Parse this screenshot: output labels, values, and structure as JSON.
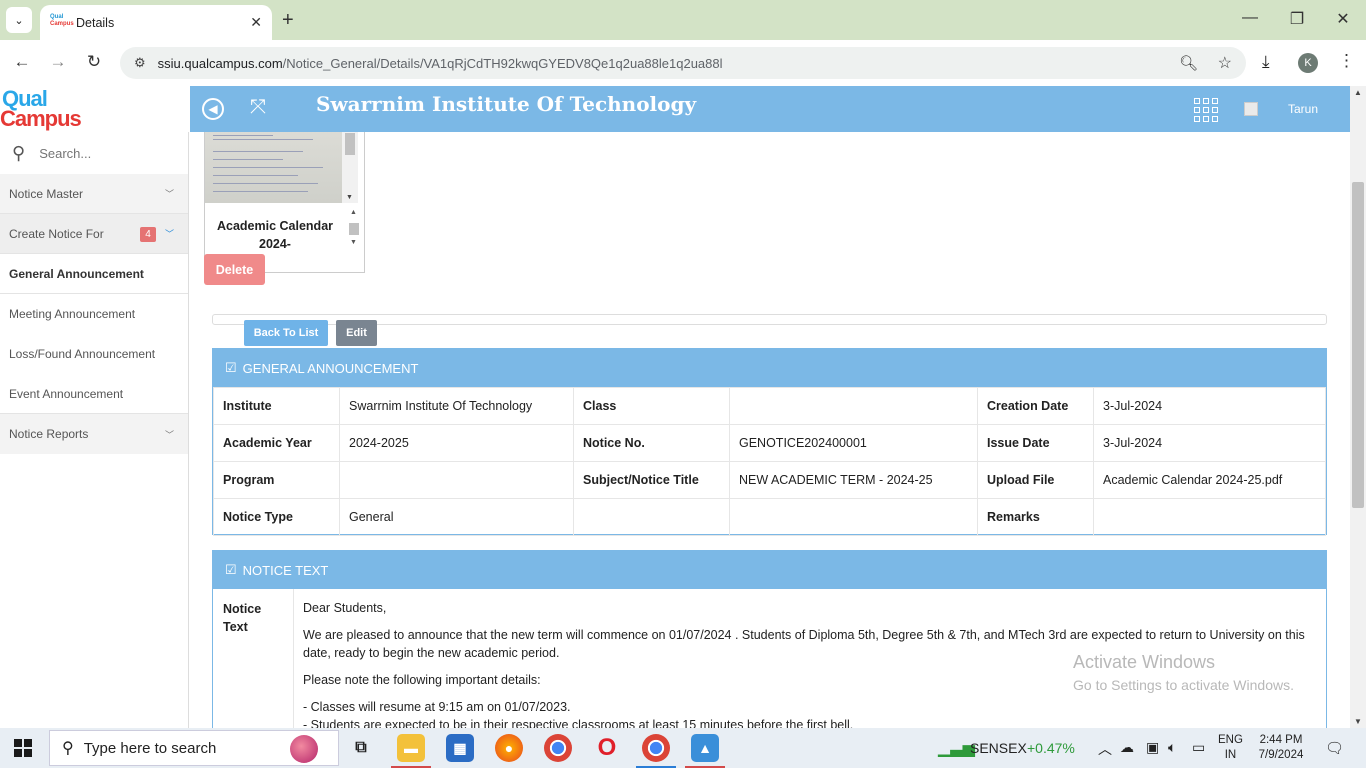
{
  "browser": {
    "tab_title": "Details",
    "favicon_text_1": "Qual",
    "favicon_text_2": "Campus",
    "url_host": "ssiu.qualcampus.com",
    "url_path": "/Notice_General/Details/VA1qRjCdTH92kwqGYEDV8Qe1q2ua88le1q2ua88l",
    "profile_initial": "K"
  },
  "header": {
    "logo_top": "Qual",
    "logo_bottom": "Campus",
    "title": "Swarrnim Institute Of Technology",
    "user_name": "Tarun"
  },
  "sidebar": {
    "search_placeholder": "Search...",
    "items": [
      {
        "label": "Notice Master",
        "has_chevron": true
      },
      {
        "label": "Create Notice For",
        "badge": "4",
        "has_chevron": true
      },
      {
        "label": "General Announcement"
      },
      {
        "label": "Meeting Announcement"
      },
      {
        "label": "Loss/Found Announcement"
      },
      {
        "label": "Event Announcement"
      },
      {
        "label": "Notice Reports",
        "has_chevron": true
      }
    ]
  },
  "attachment": {
    "name": "Academic Calendar 2024-",
    "delete_label": "Delete"
  },
  "actions": {
    "back_label": "Back To List",
    "edit_label": "Edit"
  },
  "details": {
    "heading": "GENERAL ANNOUNCEMENT",
    "rows": [
      [
        {
          "label": "Institute",
          "value": "Swarrnim Institute Of Technology"
        },
        {
          "label": "Class",
          "value": ""
        },
        {
          "label": "Creation Date",
          "value": "3-Jul-2024"
        }
      ],
      [
        {
          "label": "Academic Year",
          "value": "2024-2025"
        },
        {
          "label": "Notice No.",
          "value": "GENOTICE202400001"
        },
        {
          "label": "Issue Date",
          "value": "3-Jul-2024"
        }
      ],
      [
        {
          "label": "Program",
          "value": ""
        },
        {
          "label": "Subject/Notice Title",
          "value": "NEW ACADEMIC TERM - 2024-25"
        },
        {
          "label": "Upload File",
          "value": "Academic Calendar 2024-25.pdf"
        }
      ],
      [
        {
          "label": "Notice Type",
          "value": "General"
        },
        {
          "label": "",
          "value": ""
        },
        {
          "label": "Remarks",
          "value": ""
        }
      ]
    ]
  },
  "notice": {
    "heading": "NOTICE TEXT",
    "label_1": "Notice",
    "label_2": "Text",
    "paragraphs": [
      "Dear Students,",
      "We are pleased to announce that the new term will commence on 01/07/2024 . Students of Diploma 5th, Degree 5th & 7th, and MTech 3rd are expected to return to University on this date, ready to begin the new academic period.",
      "Please note the following important details:",
      "- Classes will resume at 9:15 am on 01/07/2023.",
      "- Students are expected to be in their respective classrooms at least 15 minutes before the first bell."
    ]
  },
  "watermark": {
    "line1": "Activate Windows",
    "line2": "Go to Settings to activate Windows."
  },
  "taskbar": {
    "search_text": "Type here to search",
    "ticker_label": "SENSEX",
    "ticker_value": "+0.47%",
    "lang_1": "ENG",
    "lang_2": "IN",
    "time": "2:44 PM",
    "date": "7/9/2024"
  }
}
